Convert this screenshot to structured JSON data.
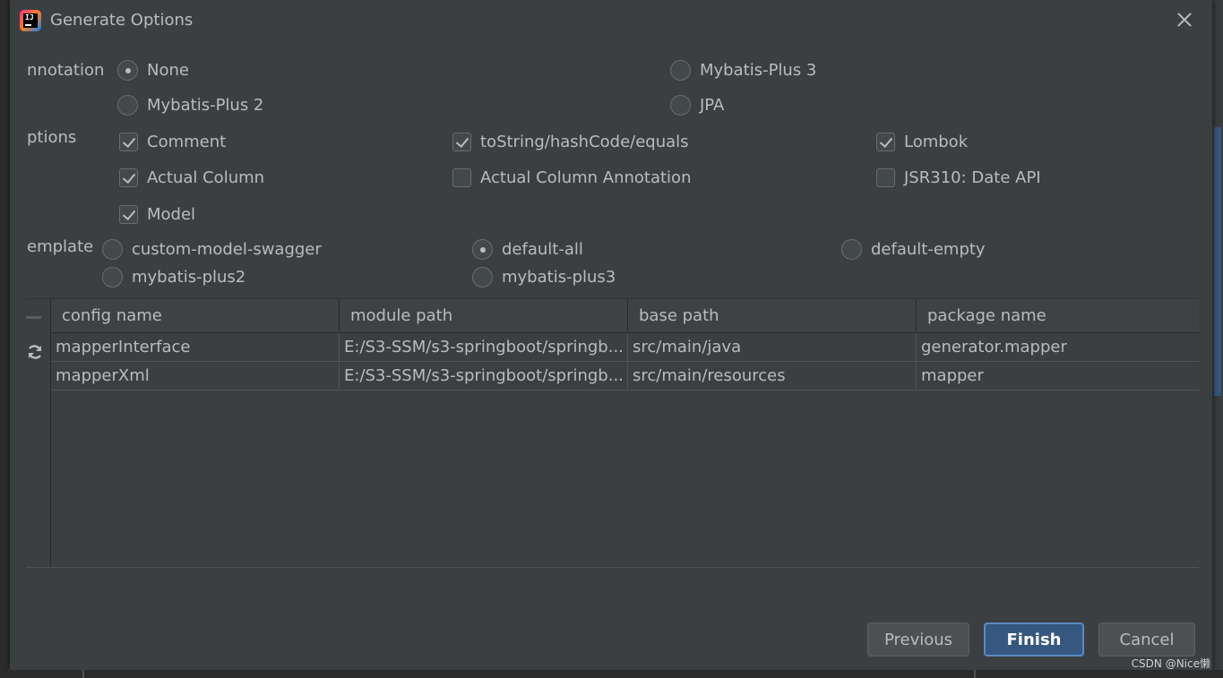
{
  "dialog": {
    "title": "Generate Options"
  },
  "annotation": {
    "label": "nnotation",
    "options": [
      {
        "label": "None",
        "selected": true
      },
      {
        "label": "Mybatis-Plus 3",
        "selected": false
      },
      {
        "label": "Mybatis-Plus 2",
        "selected": false
      },
      {
        "label": "JPA",
        "selected": false
      }
    ]
  },
  "options": {
    "label": "ptions",
    "checks": [
      {
        "label": "Comment",
        "checked": true
      },
      {
        "label": "toString/hashCode/equals",
        "checked": true
      },
      {
        "label": "Lombok",
        "checked": true
      },
      {
        "label": "Actual Column",
        "checked": true
      },
      {
        "label": "Actual Column Annotation",
        "checked": false
      },
      {
        "label": "JSR310: Date API",
        "checked": false
      },
      {
        "label": "Model",
        "checked": true
      }
    ]
  },
  "template": {
    "label": "emplate",
    "options": [
      {
        "label": "custom-model-swagger",
        "selected": false
      },
      {
        "label": "default-all",
        "selected": true
      },
      {
        "label": "default-empty",
        "selected": false
      },
      {
        "label": "mybatis-plus2",
        "selected": false
      },
      {
        "label": "mybatis-plus3",
        "selected": false
      }
    ]
  },
  "table": {
    "headers": [
      "config name",
      "module path",
      "base path",
      "package name"
    ],
    "rows": [
      [
        "mapperInterface",
        "E:/S3-SSM/s3-springboot/springb...",
        "src/main/java",
        "generator.mapper"
      ],
      [
        "mapperXml",
        "E:/S3-SSM/s3-springboot/springb...",
        "src/main/resources",
        "mapper"
      ]
    ]
  },
  "buttons": {
    "previous": "Previous",
    "finish": "Finish",
    "cancel": "Cancel"
  },
  "watermark": "CSDN @Nice懒",
  "colors": {
    "background": "#3c3f41",
    "primary_button": "#365880",
    "text": "#bbbbbb"
  }
}
